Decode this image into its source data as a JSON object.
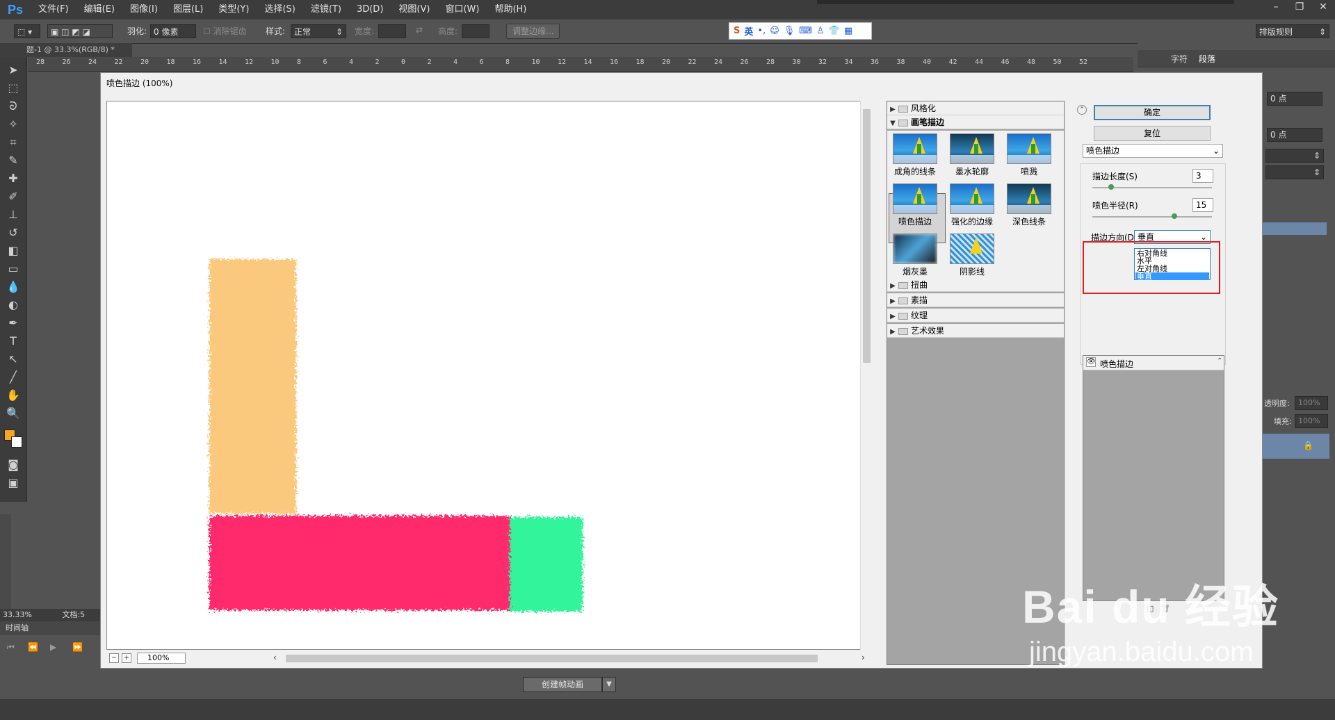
{
  "app": {
    "logo": "Ps",
    "menu": [
      "文件(F)",
      "编辑(E)",
      "图像(I)",
      "图层(L)",
      "类型(Y)",
      "选择(S)",
      "滤镜(T)",
      "3D(D)",
      "视图(V)",
      "窗口(W)",
      "帮助(H)"
    ],
    "window_buttons": [
      "–",
      "❐",
      "✕"
    ]
  },
  "options": {
    "feather_label": "羽化:",
    "feather_value": "0 像素",
    "antialias_label": "消除锯齿",
    "style_label": "样式:",
    "style_value": "正常",
    "width_label": "宽度:",
    "height_label": "高度:",
    "refine_edge": "调整边缘...",
    "workspace": "排版规则"
  },
  "ime": {
    "mode": "英"
  },
  "document": {
    "tab": "题-1 @ 33.3%(RGB/8) *",
    "ruler_ticks": [
      "28",
      "26",
      "24",
      "22",
      "20",
      "18",
      "16",
      "14",
      "12",
      "10",
      "8",
      "6",
      "4",
      "2",
      "0",
      "2",
      "4",
      "6",
      "8",
      "10",
      "12",
      "14",
      "16",
      "18",
      "20",
      "22",
      "24",
      "26",
      "28",
      "30",
      "32",
      "34",
      "36",
      "38",
      "40",
      "42",
      "44",
      "46",
      "48",
      "50",
      "52"
    ],
    "zoom_status": "33.33%",
    "doc_status": "文档:5"
  },
  "timeline": {
    "title": "时间轴",
    "create_button": "创建帧动画"
  },
  "right_panels": {
    "tabs": [
      "字符",
      "段落"
    ],
    "para_value_1": "0 点",
    "para_value_2": "0 点",
    "opacity_label": "透明度:",
    "opacity_value": "100%",
    "fill_label": "填充:",
    "fill_value": "100%"
  },
  "dialog": {
    "title": "喷色描边 (100%)",
    "zoom": "100%",
    "categories_top": [
      {
        "label": "风格化",
        "expanded": false
      },
      {
        "label": "画笔描边",
        "expanded": true
      }
    ],
    "filters": [
      "成角的线条",
      "墨水轮廓",
      "喷溅",
      "喷色描边",
      "强化的边缘",
      "深色线条",
      "烟灰墨",
      "阴影线"
    ],
    "selected_filter": "喷色描边",
    "categories_bottom": [
      "扭曲",
      "素描",
      "纹理",
      "艺术效果"
    ],
    "ok_button": "确定",
    "reset_button": "复位",
    "filter_select": "喷色描边",
    "stroke_length_label": "描边长度(S)",
    "stroke_length_value": "3",
    "spray_radius_label": "喷色半径(R)",
    "spray_radius_value": "15",
    "stroke_dir_label": "描边方向(D):",
    "stroke_dir_value": "垂直",
    "stroke_dir_options": [
      "右对角线",
      "水平",
      "左对角线",
      "垂直"
    ],
    "layer_name": "喷色描边"
  },
  "colors": {
    "orange": "#fbc97e",
    "pink": "#fe2b6c",
    "green": "#33f59b",
    "highlight": "#e02020"
  },
  "watermark": {
    "brand": "Bai du 经验",
    "url": "jingyan.baidu.com"
  }
}
